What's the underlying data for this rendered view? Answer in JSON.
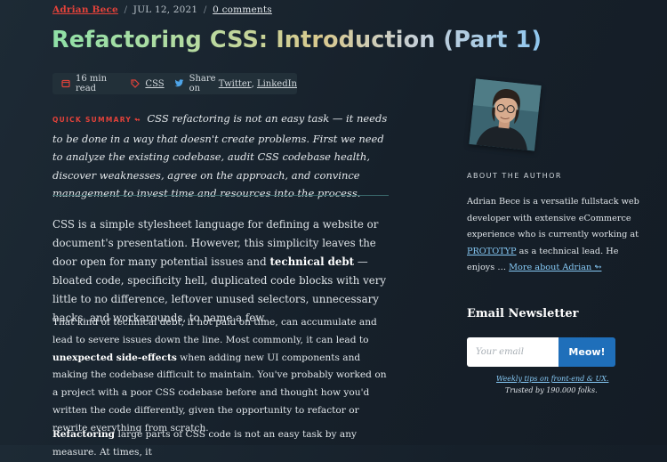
{
  "byline": {
    "author": "Adrian Bece",
    "separator": "/",
    "date": "JUL 12, 2021",
    "comments": "0 comments"
  },
  "title": "Refactoring CSS: Introduction (Part 1)",
  "meta": {
    "read_time": "16 min read",
    "tag": "CSS",
    "share_prefix": "Share on",
    "share_twitter": "Twitter",
    "share_comma": ",",
    "share_linkedin": "LinkedIn"
  },
  "summary": {
    "label": "QUICK SUMMARY",
    "arrow": "↬",
    "text": "CSS refactoring is not an easy task — it needs to be done in a way that doesn't create problems. First we need to analyze the existing codebase, audit CSS codebase health, discover weaknesses, agree on the approach, and convince management to invest time and resources into the process."
  },
  "article": {
    "p1_a": "CSS is a simple stylesheet language for defining a website or document's presentation. However, this simplicity leaves the door open for many potential issues and ",
    "p1_b": "technical debt",
    "p1_c": " — bloated code, specificity hell, duplicated code blocks with very little to no difference, leftover unused selectors, unnecessary hacks, and workarounds, to name a few.",
    "p2_a": "That kind of technical debt, if not paid on time, can accumulate and lead to severe issues down the line. Most commonly, it can lead to ",
    "p2_b": "unexpected side-effects",
    "p2_c": " when adding new UI components and making the codebase difficult to maintain. You've probably worked on a project with a poor CSS codebase before and thought how you'd written the code differently, given the opportunity to refactor or rewrite everything from scratch.",
    "p3_a": "Refactoring",
    "p3_b": " large parts of CSS code is not an easy task by any measure. At times, it"
  },
  "sidebar": {
    "about_heading": "ABOUT THE AUTHOR",
    "bio_a": "Adrian Bece is a versatile fullstack web developer with extensive eCommerce experience who is currently working at ",
    "bio_link": "PROTOTYP",
    "bio_b": " as a technical lead. He enjoys … ",
    "more_link": "More about Adrian ↬"
  },
  "newsletter": {
    "heading": "Email Newsletter",
    "placeholder": "Your email",
    "button": "Meow!",
    "tips": "Weekly tips on front-end & UX.",
    "trusted": "Trusted by 190.000 folks."
  },
  "icons": {
    "clock": "clock-icon",
    "tag": "tag-icon",
    "twitter": "twitter-icon"
  },
  "colors": {
    "background": "#1b2530",
    "accent_red": "#e3423a",
    "link_blue": "#86c9f5",
    "button_blue": "#1f6fba"
  }
}
